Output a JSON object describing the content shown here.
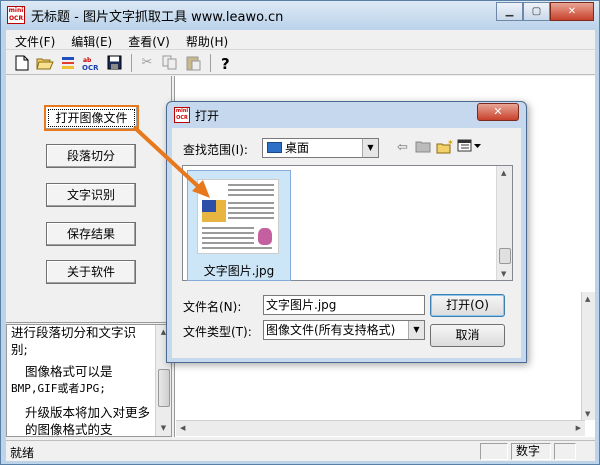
{
  "window": {
    "title": "无标题 - 图片文字抓取工具 www.leawo.cn",
    "icon_text": "mini OCR",
    "minimize_icon": "minimize-icon",
    "maximize_icon": "maximize-icon",
    "close_icon": "close-icon"
  },
  "menu": {
    "file": "文件(F)",
    "edit": "编辑(E)",
    "view": "查看(V)",
    "help": "帮助(H)"
  },
  "toolbar": {
    "icons": [
      "new-file-icon",
      "open-folder-icon",
      "segment-icon",
      "ocr-icon",
      "save-icon",
      "cut-icon",
      "copy-icon",
      "paste-icon",
      "help-icon"
    ]
  },
  "sidebar": {
    "open_image": "打开图像文件",
    "segment": "段落切分",
    "recognize": "文字识别",
    "save": "保存结果",
    "about": "关于软件"
  },
  "log": {
    "line1": "进行段落切分和文字识别;",
    "line2a": "图像格式可以是",
    "line2b": "BMP,GIF或者JPG;",
    "line3": "升级版本将加入对更多的图像格式的支"
  },
  "status": {
    "ready": "就绪",
    "indicator": "数字"
  },
  "dialog": {
    "title": "打开",
    "close_icon": "close-icon",
    "look_in_label": "查找范围(I):",
    "look_in_value": "桌面",
    "nav_icons": [
      "back-arrow-icon",
      "up-folder-icon",
      "new-folder-icon",
      "view-menu-icon"
    ],
    "file_item_name": "文字图片.jpg",
    "file_name_label": "文件名(N):",
    "file_name_value": "文字图片.jpg",
    "file_type_label": "文件类型(T):",
    "file_type_value": "图像文件(所有支持格式)",
    "open_button": "打开(O)",
    "cancel_button": "取消"
  }
}
